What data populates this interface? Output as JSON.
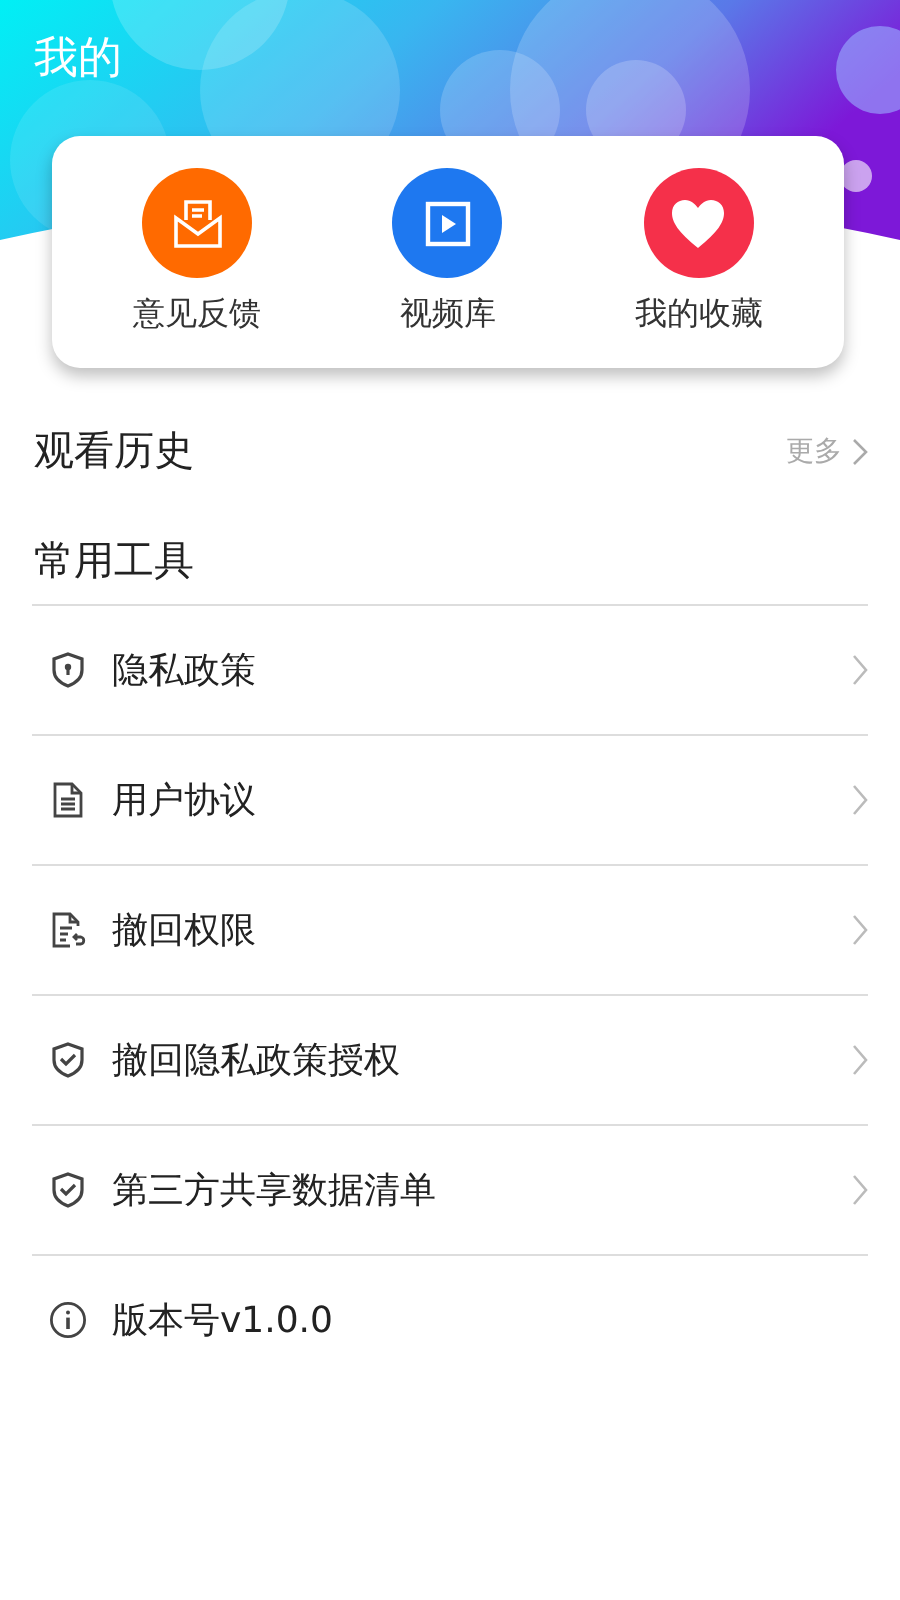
{
  "header": {
    "title": "我的"
  },
  "shortcuts": [
    {
      "kind": "feedback",
      "label": "意见反馈",
      "color": "#ff6a00"
    },
    {
      "kind": "video",
      "label": "视频库",
      "color": "#1e78f0"
    },
    {
      "kind": "favorite",
      "label": "我的收藏",
      "color": "#f5304a"
    }
  ],
  "history": {
    "title": "观看历史",
    "more": "更多"
  },
  "tools": {
    "title": "常用工具",
    "items": [
      {
        "kind": "shield-lock",
        "label": "隐私政策",
        "arrow": true
      },
      {
        "kind": "document",
        "label": "用户协议",
        "arrow": true
      },
      {
        "kind": "document-return",
        "label": "撤回权限",
        "arrow": true
      },
      {
        "kind": "shield-check",
        "label": "撤回隐私政策授权",
        "arrow": true
      },
      {
        "kind": "shield-check",
        "label": "第三方共享数据清单",
        "arrow": true
      },
      {
        "kind": "info",
        "label": "版本号v1.0.0",
        "arrow": false
      }
    ]
  }
}
